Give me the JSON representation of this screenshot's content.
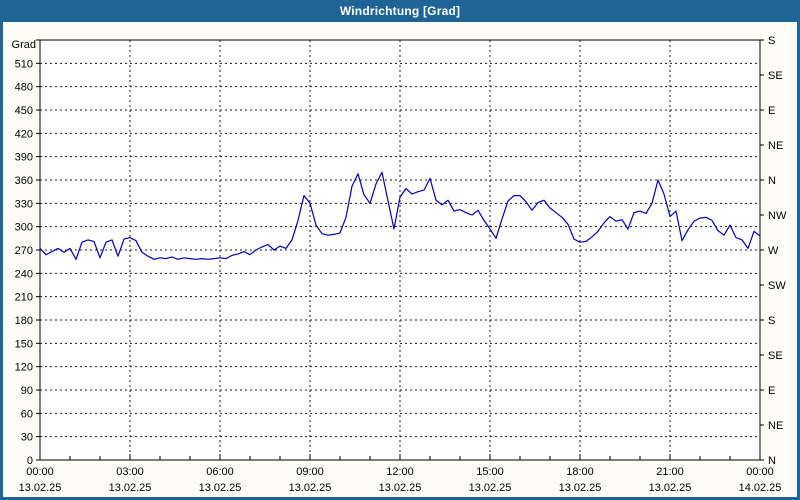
{
  "window": {
    "title": "Windrichtung [Grad]"
  },
  "colors": {
    "titlebar_bg": "#1f6496",
    "frame_border": "#1b5a88",
    "plot_background": "#fdfdf6",
    "grid": "#1a1a1a",
    "axis": "#000000",
    "line": "#0000bb",
    "title_text": "#ffffff"
  },
  "chart_data": {
    "type": "line",
    "title": "Windrichtung [Grad]",
    "grid": true,
    "legend": "none",
    "y_axis_left": {
      "unit_label": "Grad",
      "min": 0,
      "max": 540,
      "tick_step": 30,
      "tick_labels": [
        "0",
        "30",
        "60",
        "90",
        "120",
        "150",
        "180",
        "210",
        "240",
        "270",
        "300",
        "330",
        "360",
        "390",
        "420",
        "450",
        "480",
        "510"
      ]
    },
    "y_axis_right": {
      "description": "compass directions every 45 degrees",
      "ticks": [
        {
          "deg": 540,
          "label": "S"
        },
        {
          "deg": 495,
          "label": "SE"
        },
        {
          "deg": 450,
          "label": "E"
        },
        {
          "deg": 405,
          "label": "NE"
        },
        {
          "deg": 360,
          "label": "N"
        },
        {
          "deg": 315,
          "label": "NW"
        },
        {
          "deg": 270,
          "label": "W"
        },
        {
          "deg": 225,
          "label": "SW"
        },
        {
          "deg": 180,
          "label": "S"
        },
        {
          "deg": 135,
          "label": "SE"
        },
        {
          "deg": 90,
          "label": "E"
        },
        {
          "deg": 45,
          "label": "NE"
        },
        {
          "deg": 0,
          "label": "N"
        }
      ]
    },
    "x_axis": {
      "span_hours": 24,
      "major_tick_hours": 3,
      "minor_tick_hours": 1,
      "ticks": [
        {
          "hour": 0,
          "time": "00:00",
          "date": "13.02.25"
        },
        {
          "hour": 3,
          "time": "03:00",
          "date": "13.02.25"
        },
        {
          "hour": 6,
          "time": "06:00",
          "date": "13.02.25"
        },
        {
          "hour": 9,
          "time": "09:00",
          "date": "13.02.25"
        },
        {
          "hour": 12,
          "time": "12:00",
          "date": "13.02.25"
        },
        {
          "hour": 15,
          "time": "15:00",
          "date": "13.02.25"
        },
        {
          "hour": 18,
          "time": "18:00",
          "date": "13.02.25"
        },
        {
          "hour": 21,
          "time": "21:00",
          "date": "13.02.25"
        },
        {
          "hour": 24,
          "time": "00:00",
          "date": "14.02.25"
        }
      ]
    },
    "series": [
      {
        "name": "Windrichtung",
        "color": "#0000bb",
        "x_start_hours": 0,
        "x_step_hours": 0.2,
        "values": [
          272,
          264,
          268,
          272,
          267,
          272,
          258,
          280,
          283,
          281,
          260,
          280,
          283,
          262,
          284,
          286,
          282,
          267,
          262,
          258,
          260,
          259,
          261,
          258,
          260,
          259,
          258,
          259,
          258,
          259,
          260,
          259,
          263,
          265,
          268,
          264,
          270,
          274,
          277,
          270,
          275,
          272,
          283,
          308,
          340,
          330,
          302,
          291,
          289,
          290,
          292,
          312,
          352,
          368,
          341,
          330,
          355,
          370,
          333,
          297,
          338,
          349,
          342,
          345,
          347,
          362,
          334,
          328,
          334,
          320,
          322,
          318,
          315,
          321,
          308,
          297,
          285,
          310,
          333,
          340,
          340,
          332,
          321,
          331,
          334,
          324,
          318,
          312,
          303,
          284,
          280,
          281,
          287,
          294,
          305,
          313,
          307,
          309,
          297,
          318,
          320,
          317,
          330,
          360,
          342,
          313,
          320,
          282,
          296,
          307,
          311,
          312,
          308,
          295,
          289,
          302,
          286,
          283,
          272,
          294,
          288
        ]
      }
    ]
  }
}
